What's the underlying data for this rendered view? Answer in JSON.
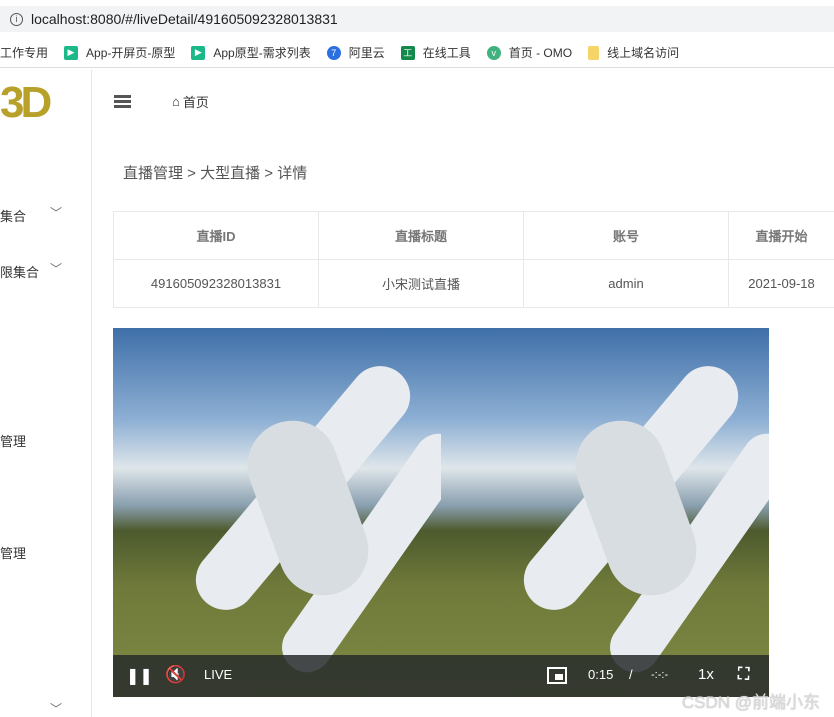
{
  "browser": {
    "url": "localhost:8080/#/liveDetail/491605092328013831",
    "bookmarks": [
      {
        "label": "工作专用",
        "icon": "none",
        "color": ""
      },
      {
        "label": "App-开屏页-原型",
        "icon": "axure-icon",
        "color": "#1bb98a"
      },
      {
        "label": "App原型-需求列表",
        "icon": "axure-icon",
        "color": "#1bb98a"
      },
      {
        "label": "阿里云",
        "icon": "aliyun-icon",
        "color": "#2b6fe0"
      },
      {
        "label": "在线工具",
        "icon": "tool-icon",
        "color": "#138a4a"
      },
      {
        "label": "首页 - OMO",
        "icon": "vue-icon",
        "color": "#3fb27f"
      },
      {
        "label": "线上域名访问",
        "icon": "folder-icon",
        "color": "#f5d56a"
      }
    ]
  },
  "app": {
    "logo": "3D",
    "home": "首页",
    "sidebar": [
      "集合",
      "限集合",
      "管理",
      "管理"
    ]
  },
  "breadcrumb": "直播管理 > 大型直播 > 详情",
  "table": {
    "headers": [
      "直播ID",
      "直播标题",
      "账号",
      "直播开始"
    ],
    "rows": [
      [
        "491605092328013831",
        "小宋测试直播",
        "admin",
        "2021-09-18"
      ]
    ]
  },
  "player": {
    "live": "LIVE",
    "time": "0:15",
    "sep": "/",
    "duration": "-:-:-",
    "speed": "1x",
    "state": "playing",
    "muted": true
  },
  "watermark": "CSDN @前端小东"
}
